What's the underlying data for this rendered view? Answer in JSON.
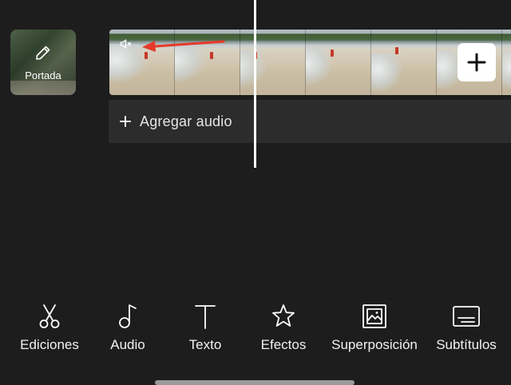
{
  "cover": {
    "label": "Portada",
    "icon": "pencil-icon"
  },
  "timeline": {
    "frame_count": 6,
    "muted_icon": "speaker-muted-icon",
    "add_clip_icon": "plus-icon"
  },
  "audio_track": {
    "label": "Agregar audio",
    "icon": "plus-icon"
  },
  "toolbar": {
    "items": [
      {
        "label": "Ediciones",
        "icon": "scissors-icon"
      },
      {
        "label": "Audio",
        "icon": "music-note-icon"
      },
      {
        "label": "Texto",
        "icon": "text-icon"
      },
      {
        "label": "Efectos",
        "icon": "star-icon"
      },
      {
        "label": "Superposición",
        "icon": "overlay-icon"
      },
      {
        "label": "Subtítulos",
        "icon": "subtitles-icon"
      }
    ]
  },
  "colors": {
    "background": "#1d1d1d",
    "audio_bar": "#2c2c2c",
    "annotation_arrow": "#e53a2a",
    "playhead": "#ffffff"
  }
}
